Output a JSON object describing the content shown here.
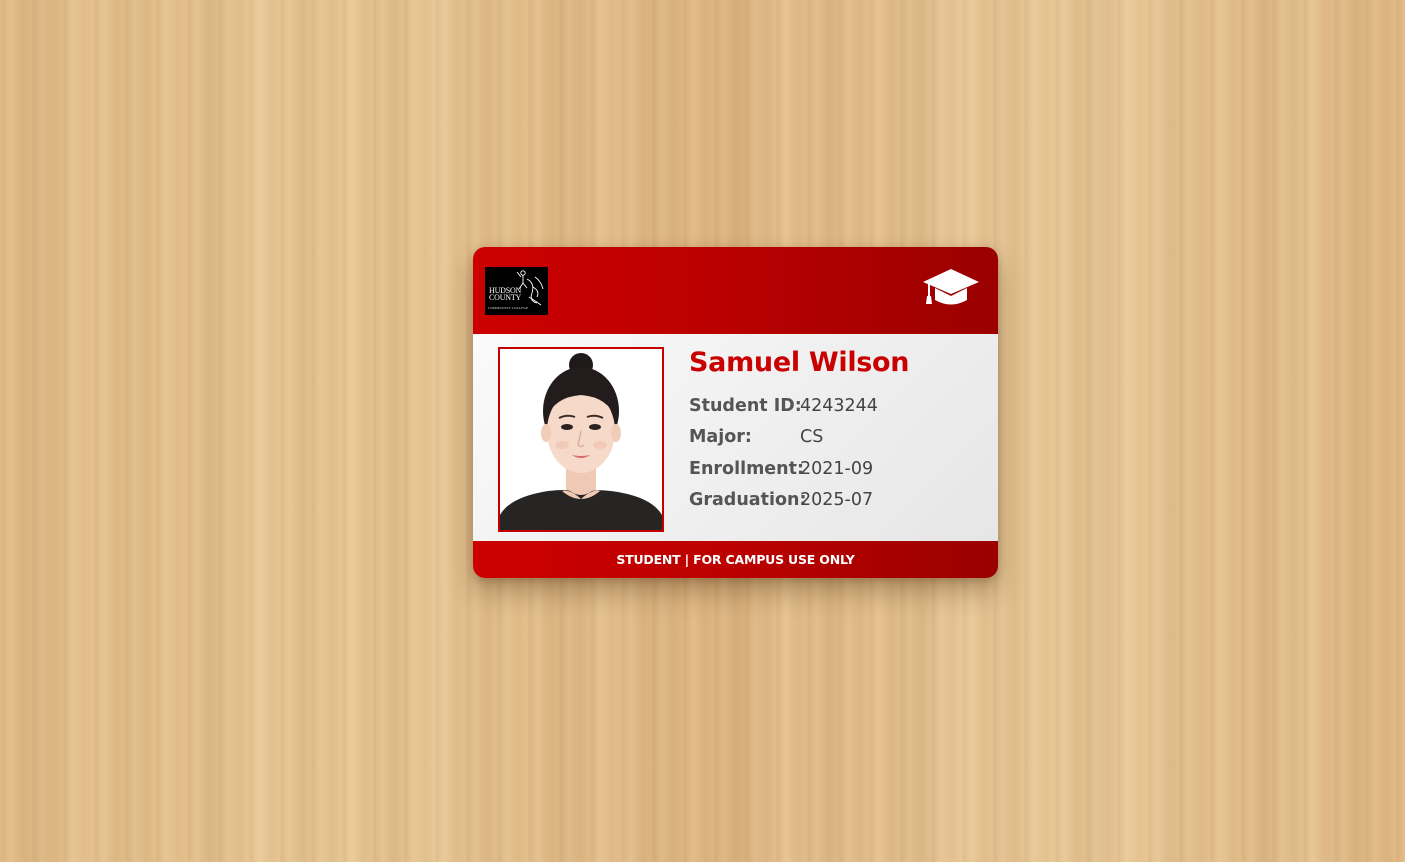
{
  "card": {
    "logo": {
      "line1": "HUDSON",
      "line2": "COUNTY",
      "line3": "COMMUNITY COLLEGE"
    },
    "header_icon": "graduation-cap-icon",
    "student_name": "Samuel Wilson",
    "fields": [
      {
        "label": "Student ID:",
        "value": "4243244"
      },
      {
        "label": "Major:",
        "value": "CS"
      },
      {
        "label": "Enrollment:",
        "value": "2021-09"
      },
      {
        "label": "Graduation:",
        "value": "2025-07"
      }
    ],
    "footer_text": "STUDENT | FOR CAMPUS USE ONLY"
  },
  "colors": {
    "brand_red": "#c80000",
    "header_dark_red": "#9a0000",
    "body_background": "#efefef",
    "label_text": "#555555"
  }
}
